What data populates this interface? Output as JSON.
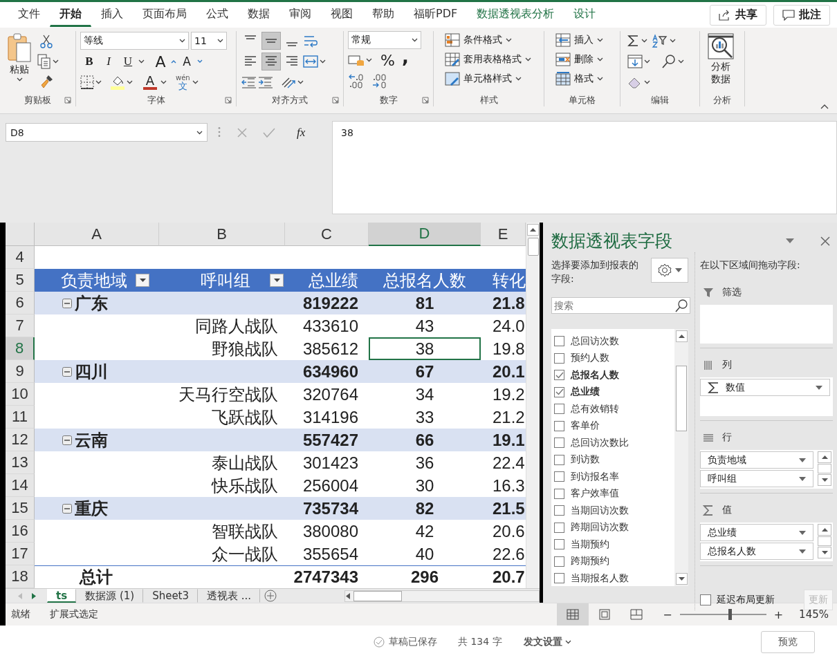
{
  "ribbon_tabs": [
    {
      "label": "文件",
      "selected": false,
      "kind": "plain"
    },
    {
      "label": "开始",
      "selected": true,
      "kind": "plain"
    },
    {
      "label": "插入",
      "selected": false,
      "kind": "plain"
    },
    {
      "label": "页面布局",
      "selected": false,
      "kind": "plain"
    },
    {
      "label": "公式",
      "selected": false,
      "kind": "plain"
    },
    {
      "label": "数据",
      "selected": false,
      "kind": "plain"
    },
    {
      "label": "审阅",
      "selected": false,
      "kind": "plain"
    },
    {
      "label": "视图",
      "selected": false,
      "kind": "plain"
    },
    {
      "label": "帮助",
      "selected": false,
      "kind": "plain"
    },
    {
      "label": "福昕PDF",
      "selected": false,
      "kind": "plain"
    },
    {
      "label": "数据透视表分析",
      "selected": false,
      "kind": "context"
    },
    {
      "label": "设计",
      "selected": false,
      "kind": "context"
    }
  ],
  "header_buttons": [
    {
      "label": "共享",
      "kind": "share"
    },
    {
      "label": "批注",
      "kind": "comment"
    }
  ],
  "ribbon": {
    "clipboard": {
      "label": "剪贴板",
      "paste": "粘贴"
    },
    "font": {
      "label": "字体",
      "font_name": "等线",
      "font_size": "11",
      "format_buttons": [
        "B",
        "I",
        "U"
      ],
      "grow": "A",
      "shrink": "A",
      "font_color": "A",
      "phonetic_top": "wén",
      "phonetic_bottom": "文"
    },
    "alignment": {
      "label": "对齐方式",
      "vertical": [
        {
          "kind": "top",
          "selected": false
        },
        {
          "kind": "middle",
          "selected": true
        },
        {
          "kind": "bottom",
          "selected": false
        }
      ],
      "horizontal": [
        {
          "kind": "left",
          "selected": false
        },
        {
          "kind": "center",
          "selected": true
        },
        {
          "kind": "right",
          "selected": false
        }
      ]
    },
    "number": {
      "label": "数字",
      "format": "常规",
      "percent": "%",
      "comma": ","
    },
    "styles": {
      "label": "样式",
      "items": [
        {
          "label": "条件格式",
          "kind": "conditional"
        },
        {
          "label": "套用表格格式",
          "kind": "table"
        },
        {
          "label": "单元格样式",
          "kind": "cell"
        }
      ]
    },
    "cells": {
      "label": "单元格",
      "items": [
        {
          "label": "插入",
          "kind": "insert"
        },
        {
          "label": "删除",
          "kind": "delete"
        },
        {
          "label": "格式",
          "kind": "format"
        }
      ]
    },
    "editing": {
      "label": "编辑"
    },
    "analysis": {
      "label": "分析",
      "button": "分析数据"
    }
  },
  "formula_bar": {
    "name_box": "D8",
    "function_label": "fx",
    "value": "38"
  },
  "sheet": {
    "columns": [
      {
        "label": "A",
        "selected": false
      },
      {
        "label": "B",
        "selected": false
      },
      {
        "label": "C",
        "selected": false
      },
      {
        "label": "D",
        "selected": true
      },
      {
        "label": "E",
        "selected": false
      }
    ],
    "rows": [
      {
        "number": "4",
        "selected": false,
        "kind": "blank"
      },
      {
        "number": "5",
        "selected": false,
        "kind": "header",
        "labels": [
          "负责地域",
          "呼叫组",
          "总业绩",
          "总报名人数",
          "转化"
        ]
      },
      {
        "number": "6",
        "selected": false,
        "kind": "region",
        "label": "广东",
        "expanded": true,
        "values": [
          "819222",
          "81",
          "21.8"
        ]
      },
      {
        "number": "7",
        "selected": false,
        "kind": "group",
        "label": "同路人战队",
        "values": [
          "433610",
          "43",
          "24.0"
        ]
      },
      {
        "number": "8",
        "selected": true,
        "kind": "group",
        "label": "野狼战队",
        "values": [
          "385612",
          "38",
          "19.8"
        ]
      },
      {
        "number": "9",
        "selected": false,
        "kind": "region",
        "label": "四川",
        "expanded": true,
        "values": [
          "634960",
          "67",
          "20.1"
        ]
      },
      {
        "number": "10",
        "selected": false,
        "kind": "group",
        "label": "天马行空战队",
        "values": [
          "320764",
          "34",
          "19.2"
        ]
      },
      {
        "number": "11",
        "selected": false,
        "kind": "group",
        "label": "飞跃战队",
        "values": [
          "314196",
          "33",
          "21.2"
        ]
      },
      {
        "number": "12",
        "selected": false,
        "kind": "region",
        "label": "云南",
        "expanded": true,
        "values": [
          "557427",
          "66",
          "19.1"
        ]
      },
      {
        "number": "13",
        "selected": false,
        "kind": "group",
        "label": "泰山战队",
        "values": [
          "301423",
          "36",
          "22.4"
        ]
      },
      {
        "number": "14",
        "selected": false,
        "kind": "group",
        "label": "快乐战队",
        "values": [
          "256004",
          "30",
          "16.3"
        ]
      },
      {
        "number": "15",
        "selected": false,
        "kind": "region",
        "label": "重庆",
        "expanded": true,
        "values": [
          "735734",
          "82",
          "21.5"
        ]
      },
      {
        "number": "16",
        "selected": false,
        "kind": "group",
        "label": "智联战队",
        "values": [
          "380080",
          "42",
          "20.6"
        ]
      },
      {
        "number": "17",
        "selected": false,
        "kind": "group",
        "label": "众一战队",
        "values": [
          "355654",
          "40",
          "22.6"
        ]
      },
      {
        "number": "18",
        "selected": false,
        "kind": "total",
        "label": "总计",
        "values": [
          "2747343",
          "296",
          "20.7"
        ]
      }
    ]
  },
  "sheet_tabs": [
    {
      "label": "ts",
      "selected": true
    },
    {
      "label": "数据源 (1)",
      "selected": false
    },
    {
      "label": "Sheet3",
      "selected": false
    },
    {
      "label": "透视表 ...",
      "selected": false
    }
  ],
  "pivot_pane": {
    "title": "数据透视表字段",
    "choose_label": "选择要添加到报表的字段:",
    "search_placeholder": "搜索",
    "fields": [
      {
        "label": "总回访次数",
        "checked": false
      },
      {
        "label": "预约人数",
        "checked": false
      },
      {
        "label": "总报名人数",
        "checked": true
      },
      {
        "label": "总业绩",
        "checked": true
      },
      {
        "label": "总有效销转",
        "checked": false
      },
      {
        "label": "客单价",
        "checked": false
      },
      {
        "label": "总回访次数比",
        "checked": false
      },
      {
        "label": "到访数",
        "checked": false
      },
      {
        "label": "到访报名率",
        "checked": false
      },
      {
        "label": "客户效率值",
        "checked": false
      },
      {
        "label": "当期回访次数",
        "checked": false
      },
      {
        "label": "跨期回访次数",
        "checked": false
      },
      {
        "label": "当期预约",
        "checked": false
      },
      {
        "label": "跨期预约",
        "checked": false
      },
      {
        "label": "当期报名人数",
        "checked": false
      }
    ],
    "drag_label": "在以下区域间拖动字段:",
    "areas": [
      {
        "kind": "filter",
        "label": "筛选"
      },
      {
        "kind": "columns",
        "label": "列",
        "items": [
          {
            "label": "数值",
            "kind": "values"
          }
        ]
      },
      {
        "kind": "rows",
        "label": "行",
        "items": [
          {
            "label": "负责地域",
            "kind": "field"
          },
          {
            "label": "呼叫组",
            "kind": "field"
          }
        ]
      },
      {
        "kind": "values",
        "label": "值",
        "items": [
          {
            "label": "总业绩",
            "kind": "field"
          },
          {
            "label": "总报名人数",
            "kind": "field"
          }
        ]
      }
    ],
    "defer": {
      "label": "延迟布局更新",
      "checked": false
    },
    "update_button": {
      "label": "更新",
      "disabled": true
    }
  },
  "status_bar": {
    "items": [
      "就绪",
      "扩展式选定"
    ],
    "views": [
      {
        "kind": "normal",
        "selected": true
      },
      {
        "kind": "page_layout",
        "selected": false
      },
      {
        "kind": "page_break",
        "selected": false
      }
    ],
    "zoom_out": "−",
    "zoom_in": "+",
    "zoom": {
      "level": 0.58
    },
    "zoom_label": "145%"
  },
  "editor_footer": {
    "save_status": "草稿已保存",
    "word_count": "共 134 字",
    "publish_settings": "发文设置",
    "preview_button": "预览"
  }
}
